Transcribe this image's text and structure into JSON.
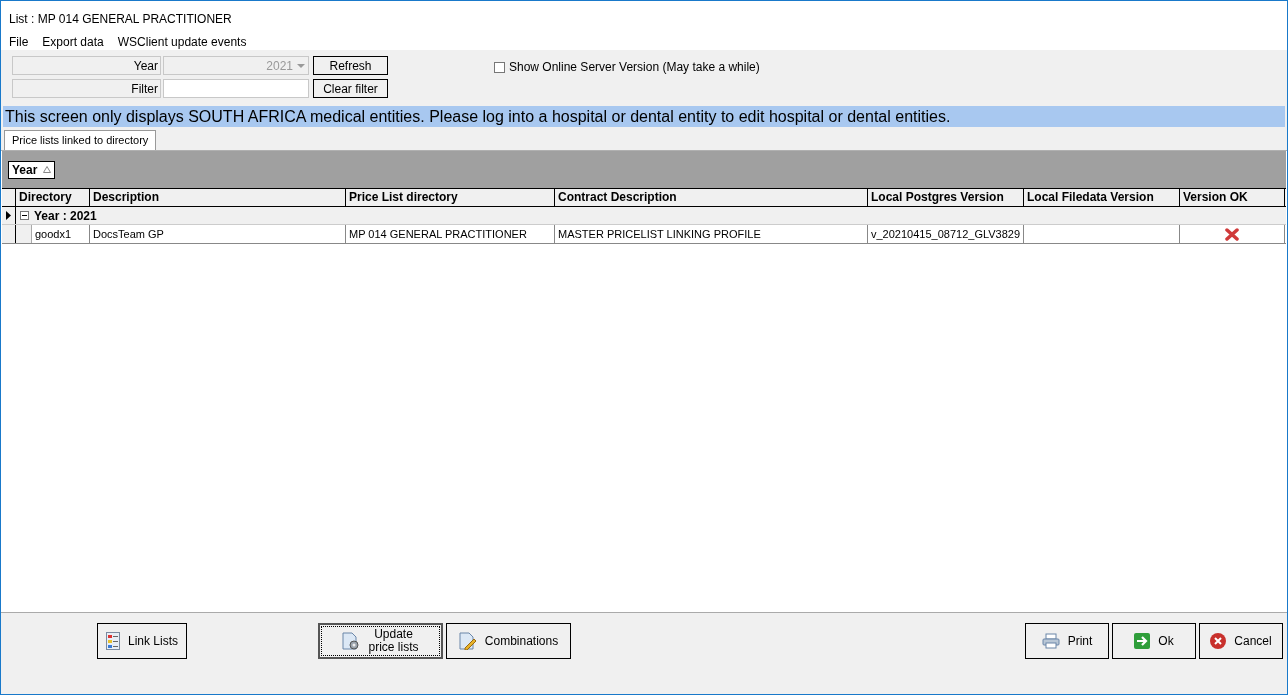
{
  "window": {
    "title": "List : MP 014 GENERAL PRACTITIONER"
  },
  "menu": [
    "File",
    "Export data",
    "WSClient update events"
  ],
  "filters": {
    "year_label": "Year",
    "year_value": "2021",
    "refresh": "Refresh",
    "filter_label": "Filter",
    "clear": "Clear filter",
    "online": {
      "label": "Show Online Server Version (May take a while)",
      "checked": false
    }
  },
  "banner": "This screen only displays SOUTH AFRICA medical entities. Please log into a hospital or dental entity to edit hospital or dental entities.",
  "tabs": [
    {
      "label": "Price lists linked to directory",
      "selected": true
    }
  ],
  "group_by": "Year",
  "table": {
    "columns": [
      "Directory",
      "Description",
      "Price List directory",
      "Contract Description",
      "Local Postgres Version",
      "Local Filedata Version",
      "Version OK"
    ],
    "groups": [
      {
        "label": "Year : 2021",
        "expanded": true,
        "selected": true,
        "rows": [
          {
            "cells": [
              "goodx1",
              "DocsTeam GP",
              "MP 014 GENERAL PRACTITIONER",
              "MASTER PRICELIST LINKING PROFILE",
              "v_20210415_08712_GLV3829",
              ""
            ],
            "version_ok": false
          }
        ]
      }
    ]
  },
  "left_buttons": [
    {
      "label": "Link Lists",
      "kind": "link",
      "focused": false
    },
    {
      "label": "Update\nprice lists",
      "kind": "update",
      "focused": true
    },
    {
      "label": "Combinations",
      "kind": "combine",
      "focused": false
    }
  ],
  "right_buttons": [
    {
      "label": "Print",
      "kind": "print",
      "focused": false
    },
    {
      "label": "Ok",
      "kind": "ok",
      "focused": false
    },
    {
      "label": "Cancel",
      "kind": "cancel",
      "focused": false
    }
  ]
}
